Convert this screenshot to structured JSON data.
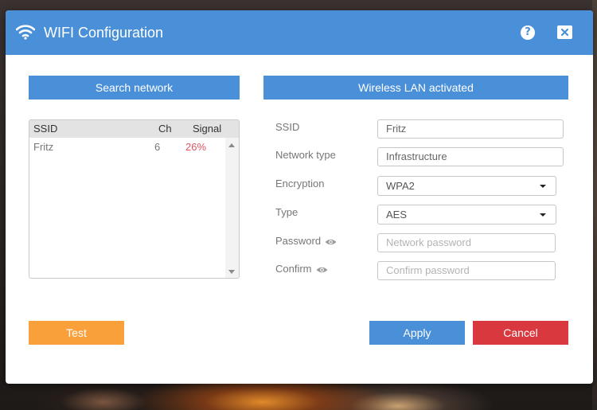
{
  "dialog": {
    "title": "WIFI Configuration",
    "help_label": "?",
    "icons": {
      "title": "wifi-icon",
      "help": "help-icon",
      "close": "close-icon"
    }
  },
  "search": {
    "header": "Search network",
    "columns": {
      "ssid": "SSID",
      "channel": "Ch",
      "signal": "Signal"
    },
    "rows": [
      {
        "ssid": "Fritz",
        "channel": "6",
        "signal": "26%"
      }
    ]
  },
  "wlan": {
    "header": "Wireless LAN activated",
    "fields": {
      "ssid": {
        "label": "SSID",
        "value": "Fritz"
      },
      "network_type": {
        "label": "Network type",
        "value": "Infrastructure"
      },
      "encryption": {
        "label": "Encryption",
        "value": "WPA2"
      },
      "type": {
        "label": "Type",
        "value": "AES"
      },
      "password": {
        "label": "Password",
        "placeholder": "Network password"
      },
      "confirm": {
        "label": "Confirm",
        "placeholder": "Confirm password"
      }
    }
  },
  "buttons": {
    "test": "Test",
    "apply": "Apply",
    "cancel": "Cancel"
  },
  "colors": {
    "accent": "#4a90d9",
    "test": "#f9a03a",
    "cancel": "#d9383f",
    "signal_weak": "#e0555f"
  }
}
